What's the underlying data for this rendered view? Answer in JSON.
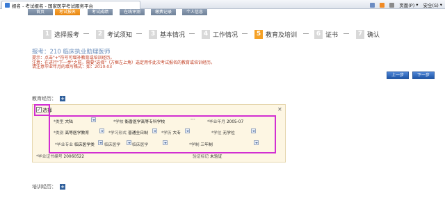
{
  "browser": {
    "tab_title": "报名 - 考试报名 - 国家医学考试服务平台",
    "toolbar": {
      "home": "",
      "print": "",
      "page": "页面(P)",
      "safety": "安全(S)"
    }
  },
  "nav": {
    "items": [
      "首页",
      "考试报名",
      "考试成绩",
      "在线评测",
      "缴费记录",
      "个人信息"
    ],
    "active_index": 1
  },
  "steps": [
    {
      "num": "1",
      "label": "选择报考"
    },
    {
      "num": "2",
      "label": "考试须知"
    },
    {
      "num": "3",
      "label": "基本情况"
    },
    {
      "num": "4",
      "label": "工作情况"
    },
    {
      "num": "5",
      "label": "教育及培训"
    },
    {
      "num": "6",
      "label": "证书"
    },
    {
      "num": "7",
      "label": "确认"
    }
  ],
  "active_step": 5,
  "page_title": "报考：210 临床执业助理医师",
  "notes": [
    "提示：点击\"+\"符号可增补教育或培训经历。",
    "注意：在进行\"下一步\"之前，需要\"选择\"（方框左上角）选定用作此次考试报名的教育或培训经历。",
    "请注意毕业年月的填写格式：如：2010-03"
  ],
  "buttons": {
    "prev": "上一步",
    "next": "下一步"
  },
  "education": {
    "section_label": "教育经历：",
    "select_label": "选择",
    "fields": {
      "type_label": "*类型",
      "type_value": "大陆",
      "school_label": "*学校",
      "school_value": "衡香医学高等专科学校",
      "dash": "---",
      "grad_label": "*毕业年月",
      "grad_value": "2005-07",
      "category_label": "*类别",
      "category_value": "高等医学教育",
      "mode_label": "*学习形式",
      "mode_value": "普通全日制",
      "edu_label": "*学历",
      "edu_value": "大专",
      "degree_label": "*学位",
      "degree_value": "无学位",
      "major_label": "*毕业专业",
      "major_value1": "临床医学类",
      "major_value2": "临床医学",
      "major_value3": "临床医学",
      "duration_label": "*学制",
      "duration_value": "三年制",
      "cert_label": "*毕业证书编号",
      "cert_value": "20060522",
      "verify_label": "验证标记",
      "verify_value": "未验证"
    }
  },
  "training": {
    "section_label": "培训经历："
  }
}
